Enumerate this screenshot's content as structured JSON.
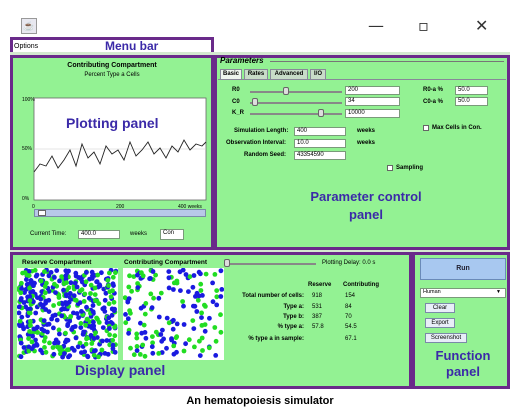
{
  "window": {
    "minimize": "—",
    "restore": "▫",
    "close": "✕"
  },
  "menu": {
    "options": "Options"
  },
  "annotations": {
    "menu_bar": "Menu bar",
    "plotting_panel": "Plotting panel",
    "parameter_panel": "Parameter control panel",
    "display_panel": "Display panel",
    "function_panel": "Function panel"
  },
  "plot": {
    "title": "Contributing Compartment",
    "subtitle": "Percent Type a Cells",
    "y_ticks": [
      "100%",
      "50%",
      "0%"
    ],
    "x_ticks": [
      "0",
      "200",
      "400 weeks"
    ],
    "current_time_label": "Current Time:",
    "current_time_value": "400.0",
    "weeks_label": "weeks",
    "compartment_select": "Con"
  },
  "parameters": {
    "header": "Parameters",
    "tabs": [
      "Basic",
      "Rates",
      "Advanced",
      "I/O"
    ],
    "r0_label": "R0",
    "r0_value": "200",
    "c0_label": "C0",
    "c0_value": "34",
    "kr_label": "K_R",
    "kr_value": "10000",
    "r0a_label": "R0-a %",
    "r0a_value": "50.0",
    "c0a_label": "C0-a %",
    "c0a_value": "50.0",
    "max_cells_label": "Max Cells in Con.",
    "sim_length_label": "Simulation Length:",
    "sim_length_value": "400",
    "obs_interval_label": "Observation Interval:",
    "obs_interval_value": "10.0",
    "seed_label": "Random Seed:",
    "seed_value": "43354590",
    "weeks1": "weeks",
    "weeks2": "weeks",
    "sampling_label": "Sampling"
  },
  "display": {
    "reserve_title": "Reserve Compartment",
    "contributing_title": "Contributing Compartment",
    "plotting_delay": "Plotting Delay: 0.0 s",
    "col_reserve": "Reserve",
    "col_contributing": "Contributing",
    "rows": [
      {
        "label": "Total number of cells:",
        "reserve": "918",
        "contributing": "154"
      },
      {
        "label": "Type a:",
        "reserve": "531",
        "contributing": "84"
      },
      {
        "label": "Type b:",
        "reserve": "387",
        "contributing": "70"
      },
      {
        "label": "% type a:",
        "reserve": "57.8",
        "contributing": "54.5"
      },
      {
        "label": "% type a in sample:",
        "reserve": "",
        "contributing": "67.1"
      }
    ]
  },
  "functions": {
    "run": "Run",
    "species": "Human",
    "clear": "Clear",
    "export": "Export",
    "screenshot": "Screenshot"
  },
  "caption": "An hematopoiesis simulator",
  "colors": {
    "panel_green": "#93f293",
    "frame_purple": "#6a2a8a",
    "dot_blue": "#1a1ae0",
    "dot_green": "#22dd22"
  }
}
